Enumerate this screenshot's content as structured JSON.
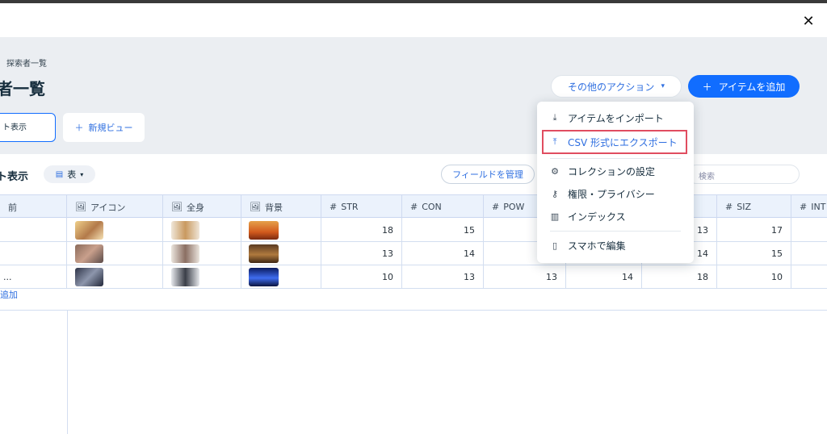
{
  "window": {
    "close_label": "✕"
  },
  "breadcrumb": "探索者一覧",
  "page_title": "者一覧",
  "actions": {
    "more_label": "その他のアクション",
    "add_label": "アイテムを追加"
  },
  "views": {
    "current_view": "ト表示",
    "new_view_label": "新規ビュー"
  },
  "toolbar": {
    "title": "ト表示",
    "view_type": "表",
    "manage_fields": "フィールドを管理",
    "search_placeholder": "検索"
  },
  "table": {
    "columns": [
      {
        "label": "前"
      },
      {
        "label": "アイコン",
        "icon": "image-icon"
      },
      {
        "label": "全身",
        "icon": "image-icon"
      },
      {
        "label": "背景",
        "icon": "image-icon"
      },
      {
        "label": "STR",
        "icon": "hash-icon"
      },
      {
        "label": "CON",
        "icon": "hash-icon"
      },
      {
        "label": "POW",
        "icon": "hash-icon"
      },
      {
        "label": "",
        "icon": ""
      },
      {
        "label": "",
        "icon": ""
      },
      {
        "label": "SIZ",
        "icon": "hash-icon"
      },
      {
        "label": "INT",
        "icon": "hash-icon"
      }
    ],
    "rows": [
      {
        "name": "",
        "str": "18",
        "con": "15",
        "pow": "",
        "c8": "",
        "c9": "13",
        "siz": "17"
      },
      {
        "name": "",
        "str": "13",
        "con": "14",
        "pow": "",
        "c8": "",
        "c9": "14",
        "siz": "15"
      },
      {
        "name": "...",
        "str": "10",
        "con": "13",
        "pow": "13",
        "c8": "14",
        "c9": "18",
        "siz": "10"
      }
    ],
    "add_row_label": "追加"
  },
  "menu": {
    "items": [
      {
        "label": "アイテムをインポート",
        "icon": "download-icon"
      },
      {
        "label": "CSV 形式にエクスポート",
        "icon": "upload-icon",
        "highlighted": true
      },
      {
        "label": "コレクションの設定",
        "icon": "gear-icon"
      },
      {
        "label": "権限・プライバシー",
        "icon": "key-icon"
      },
      {
        "label": "インデックス",
        "icon": "index-icon"
      },
      {
        "label": "スマホで編集",
        "icon": "mobile-icon"
      }
    ]
  },
  "colors": {
    "accent": "#116dff",
    "highlight_border": "#e04d60",
    "header_bg": "#ebeef2"
  }
}
